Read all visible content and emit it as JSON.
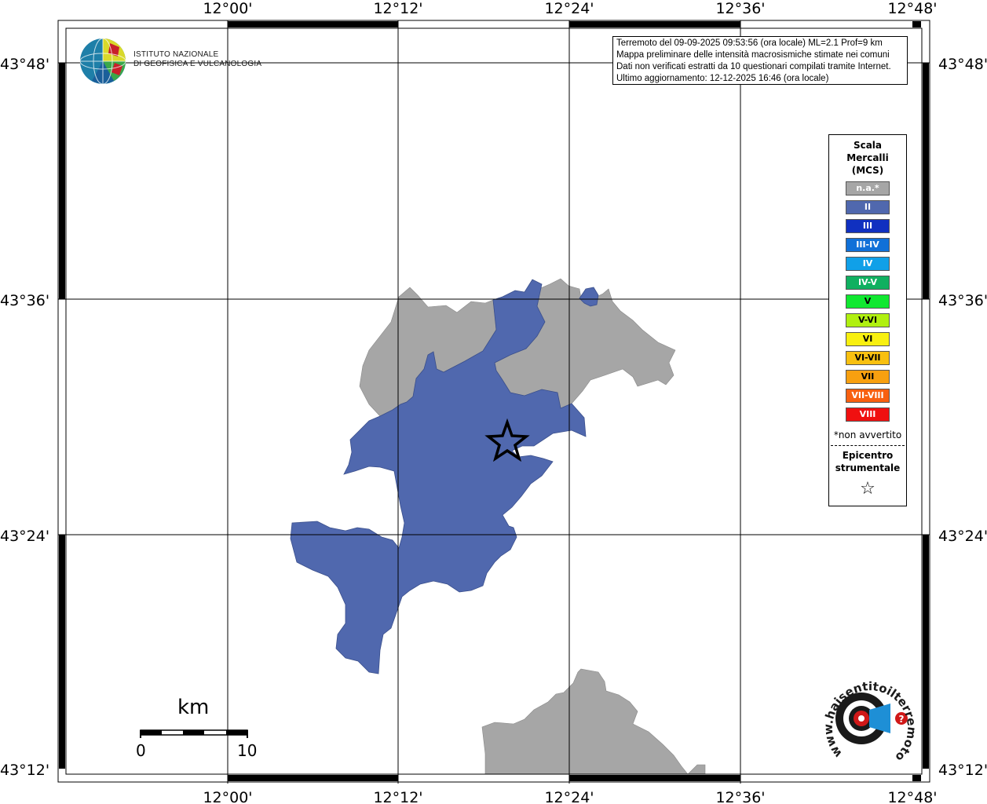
{
  "map": {
    "lon_labels": [
      "12°00'",
      "12°12'",
      "12°24'",
      "12°36'",
      "12°48'"
    ],
    "lat_labels": [
      "43°48'",
      "43°36'",
      "43°24'",
      "43°12'"
    ]
  },
  "logo": {
    "line1": "ISTITUTO NAZIONALE",
    "line2": "DI GEOFISICA E VULCANOLOGIA"
  },
  "info": {
    "line1": "Terremoto del 09-09-2025 09:53:56 (ora locale) ML=2.1 Prof=9 km",
    "line2": "Mappa preliminare delle intensità macrosismiche stimate nei comuni",
    "line3": "Dati non verificati estratti da 10 questionari compilati tramite Internet.",
    "line4": "Ultimo aggiornamento: 12-12-2025 16:46 (ora locale)"
  },
  "legend": {
    "title_line1": "Scala",
    "title_line2": "Mercalli",
    "title_line3": "(MCS)",
    "items": [
      {
        "label": "n.a.*",
        "color": "#a6a6a6"
      },
      {
        "label": "II",
        "color": "#5068ae"
      },
      {
        "label": "III",
        "color": "#1030c0"
      },
      {
        "label": "III-IV",
        "color": "#1070d8"
      },
      {
        "label": "IV",
        "color": "#10a0e8"
      },
      {
        "label": "IV-V",
        "color": "#10b060"
      },
      {
        "label": "V",
        "color": "#10e830"
      },
      {
        "label": "V-VI",
        "color": "#b0f010"
      },
      {
        "label": "VI",
        "color": "#f8f010"
      },
      {
        "label": "VI-VII",
        "color": "#f8c010"
      },
      {
        "label": "VII",
        "color": "#f8a010"
      },
      {
        "label": "VII-VIII",
        "color": "#f86010"
      },
      {
        "label": "VIII",
        "color": "#f01010"
      }
    ],
    "note": "*non avvertito",
    "epicenter_line1": "Epicentro",
    "epicenter_line2": "strumentale",
    "epicenter_symbol": "☆"
  },
  "scalebar": {
    "unit": "km",
    "min": "0",
    "max": "10"
  },
  "watermark": {
    "text": "www.haisentitoilterremoto.it"
  },
  "colors": {
    "intensity_II": "#5068ae",
    "not_felt": "#a6a6a6"
  }
}
